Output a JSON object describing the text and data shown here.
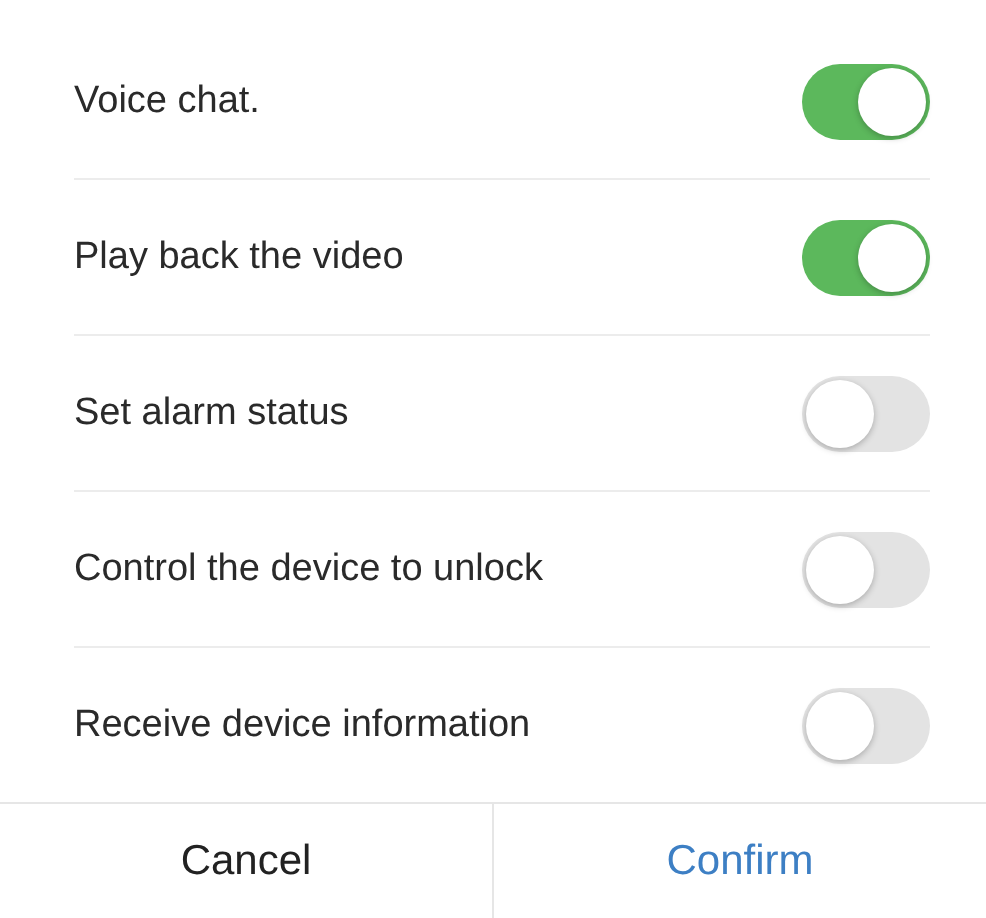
{
  "settings": [
    {
      "label": "Voice chat.",
      "on": true
    },
    {
      "label": "Play back the video",
      "on": true
    },
    {
      "label": "Set alarm status",
      "on": false
    },
    {
      "label": "Control the device to unlock",
      "on": false
    },
    {
      "label": "Receive device information",
      "on": false
    }
  ],
  "buttons": [
    {
      "label": "Cancel",
      "kind": "cancel"
    },
    {
      "label": "Confirm",
      "kind": "confirm"
    }
  ]
}
